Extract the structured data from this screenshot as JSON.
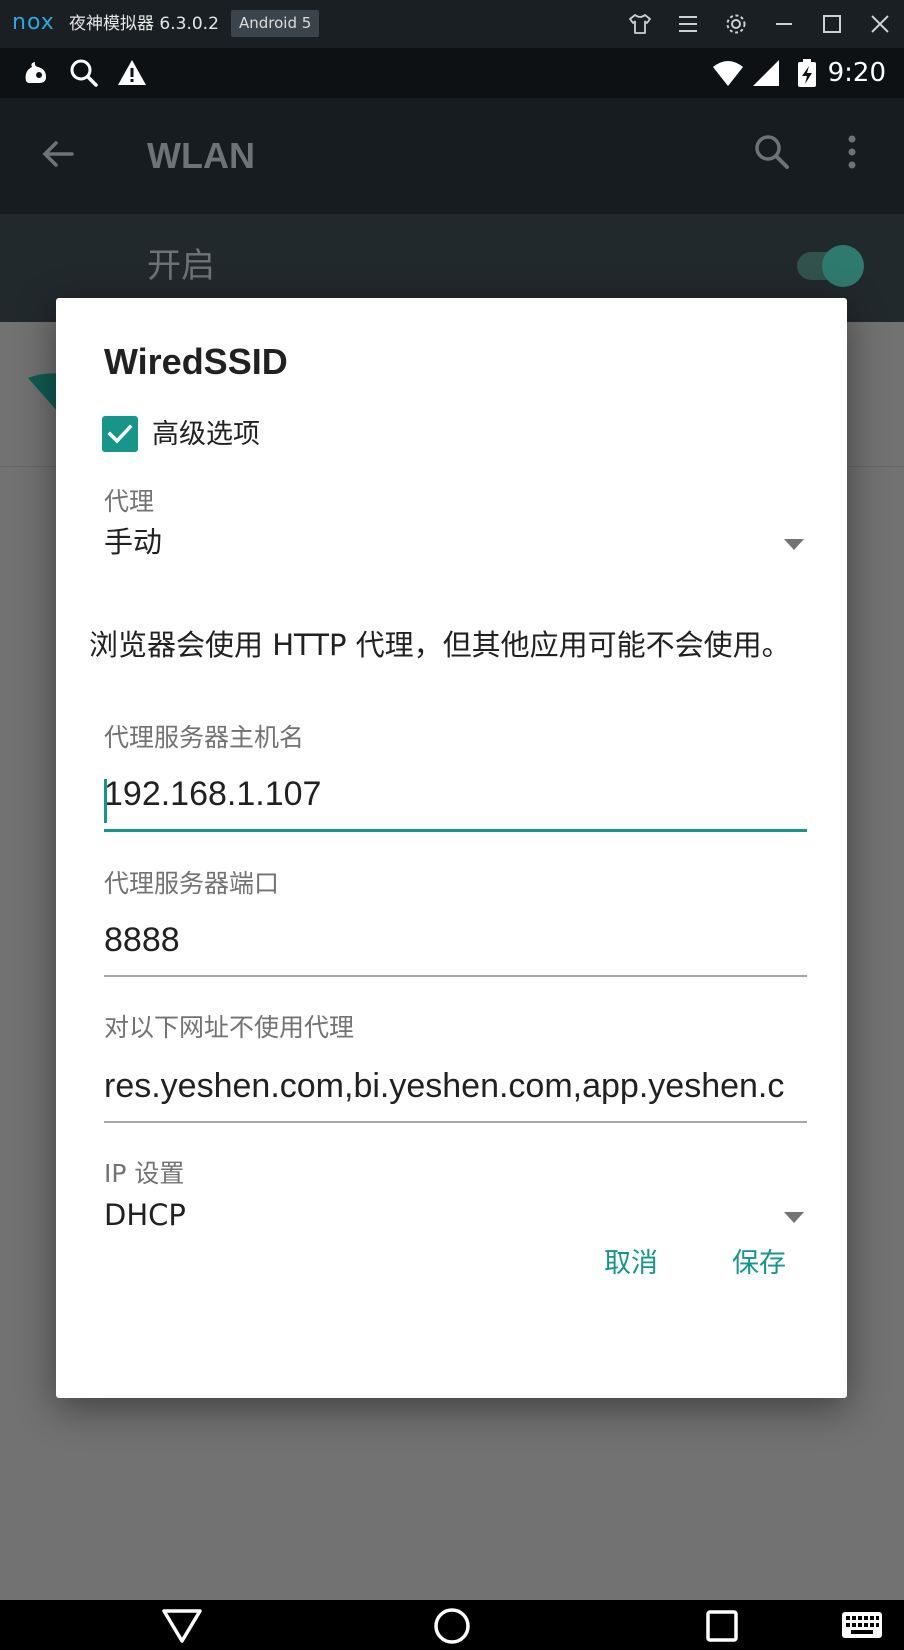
{
  "emulator": {
    "logo": "nox",
    "title": "夜神模拟器 6.3.0.2",
    "android_badge": "Android 5",
    "controls": [
      "shirt-icon",
      "menu-icon",
      "gear-icon",
      "minimize-icon",
      "maximize-icon",
      "close-icon"
    ]
  },
  "status_bar": {
    "left_icons": [
      "uc-browser-icon",
      "search-icon",
      "warning-icon"
    ],
    "right_icons": [
      "wifi-icon",
      "signal-icon",
      "battery-charging-icon"
    ],
    "time": "9:20"
  },
  "background_screen": {
    "app_title": "WLAN",
    "switch_label": "开启",
    "switch_on": true,
    "accent_color": "#2f7a6f"
  },
  "dialog": {
    "title": "WiredSSID",
    "advanced_checkbox": {
      "label": "高级选项",
      "checked": true
    },
    "proxy": {
      "label": "代理",
      "value": "手动"
    },
    "note": "浏览器会使用 HTTP 代理，但其他应用可能不会使用。",
    "proxy_hostname": {
      "label": "代理服务器主机名",
      "value": "192.168.1.107"
    },
    "proxy_port": {
      "label": "代理服务器端口",
      "value": "8888"
    },
    "bypass": {
      "label": "对以下网址不使用代理",
      "value": "res.yeshen.com,bi.yeshen.com,app.yeshen.c"
    },
    "ip_settings": {
      "label": "IP 设置",
      "value": "DHCP"
    },
    "cancel_label": "取消",
    "save_label": "保存",
    "accent_color": "#159688"
  },
  "nav_bar": {
    "icons": [
      "back-triangle-icon",
      "home-circle-icon",
      "recents-square-icon",
      "keyboard-icon"
    ]
  }
}
